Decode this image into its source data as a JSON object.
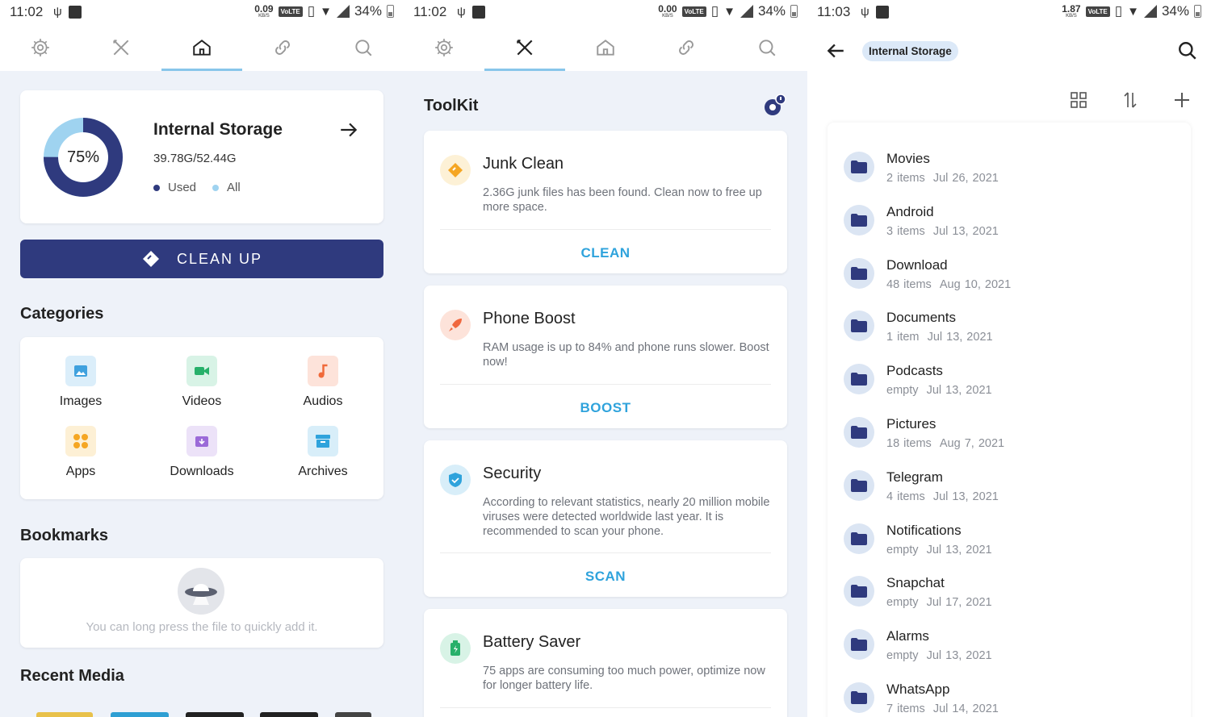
{
  "panel1": {
    "status": {
      "time": "11:02",
      "speed": "0.09",
      "speed_unit": "KB/S",
      "volte": "VoLTE",
      "battery": "34%"
    },
    "storage": {
      "title": "Internal Storage",
      "percent": "75%",
      "used_fraction": 0.75,
      "size": "39.78G/52.44G",
      "legend_used": "Used",
      "legend_all": "All"
    },
    "cleanup_label": "CLEAN UP",
    "categories_title": "Categories",
    "categories": [
      {
        "label": "Images",
        "icon": "image-icon",
        "color": "#3fa1de",
        "bg": "#dbeefa"
      },
      {
        "label": "Videos",
        "icon": "video-icon",
        "color": "#27b06a",
        "bg": "#d8f3e6"
      },
      {
        "label": "Audios",
        "icon": "music-icon",
        "color": "#f06a3a",
        "bg": "#fde3da"
      },
      {
        "label": "Apps",
        "icon": "apps-icon",
        "color": "#f5a623",
        "bg": "#fdf0d5"
      },
      {
        "label": "Downloads",
        "icon": "download-icon",
        "color": "#9b6ad8",
        "bg": "#ece2f8"
      },
      {
        "label": "Archives",
        "icon": "archive-icon",
        "color": "#2fa3dc",
        "bg": "#d8eef9"
      }
    ],
    "bookmarks_title": "Bookmarks",
    "bookmarks_empty": "You can long press the file to quickly add it.",
    "recent_title": "Recent Media"
  },
  "panel2": {
    "status": {
      "time": "11:02",
      "speed": "0.00",
      "speed_unit": "KB/S",
      "volte": "VoLTE",
      "battery": "34%"
    },
    "title": "ToolKit",
    "tools": [
      {
        "name": "Junk Clean",
        "desc": "2.36G junk files has been found. Clean now to free up more space.",
        "action": "CLEAN",
        "icon": "broom-icon",
        "color": "#f5a623",
        "bg": "#fdf1d6"
      },
      {
        "name": "Phone Boost",
        "desc": "RAM usage is up to 84% and phone runs slower. Boost now!",
        "action": "BOOST",
        "icon": "rocket-icon",
        "color": "#f0683f",
        "bg": "#fde3da"
      },
      {
        "name": "Security",
        "desc": "According to relevant statistics, nearly 20 million mobile viruses were detected worldwide last year. It is recommended to scan your phone.",
        "action": "SCAN",
        "icon": "shield-icon",
        "color": "#2fa3dc",
        "bg": "#d8eef9"
      },
      {
        "name": "Battery Saver",
        "desc": "75 apps are consuming too much power, optimize now for longer battery life.",
        "action": "",
        "icon": "battery-icon",
        "color": "#27b06a",
        "bg": "#d8f3e6"
      }
    ]
  },
  "panel3": {
    "status": {
      "time": "11:03",
      "speed": "1.87",
      "speed_unit": "KB/S",
      "volte": "VoLTE",
      "battery": "34%"
    },
    "breadcrumb": "Internal Storage",
    "folders": [
      {
        "name": "Movies",
        "count": "2 items",
        "date": "Jul 26, 2021"
      },
      {
        "name": "Android",
        "count": "3 items",
        "date": "Jul 13, 2021"
      },
      {
        "name": "Download",
        "count": "48 items",
        "date": "Aug 10, 2021"
      },
      {
        "name": "Documents",
        "count": "1 item",
        "date": "Jul 13, 2021"
      },
      {
        "name": "Podcasts",
        "count": "empty",
        "date": "Jul 13, 2021"
      },
      {
        "name": "Pictures",
        "count": "18 items",
        "date": "Aug 7, 2021"
      },
      {
        "name": "Telegram",
        "count": "4 items",
        "date": "Jul 13, 2021"
      },
      {
        "name": "Notifications",
        "count": "empty",
        "date": "Jul 13, 2021"
      },
      {
        "name": "Snapchat",
        "count": "empty",
        "date": "Jul 17, 2021"
      },
      {
        "name": "Alarms",
        "count": "empty",
        "date": "Jul 13, 2021"
      },
      {
        "name": "WhatsApp",
        "count": "7 items",
        "date": "Jul 14, 2021"
      }
    ]
  },
  "colors": {
    "accent": "#2f3a7e",
    "link": "#2fa3dc",
    "tab_indicator": "#88c6ea",
    "donut_all": "#9fd3f0",
    "folder": "#2f3a7e"
  }
}
